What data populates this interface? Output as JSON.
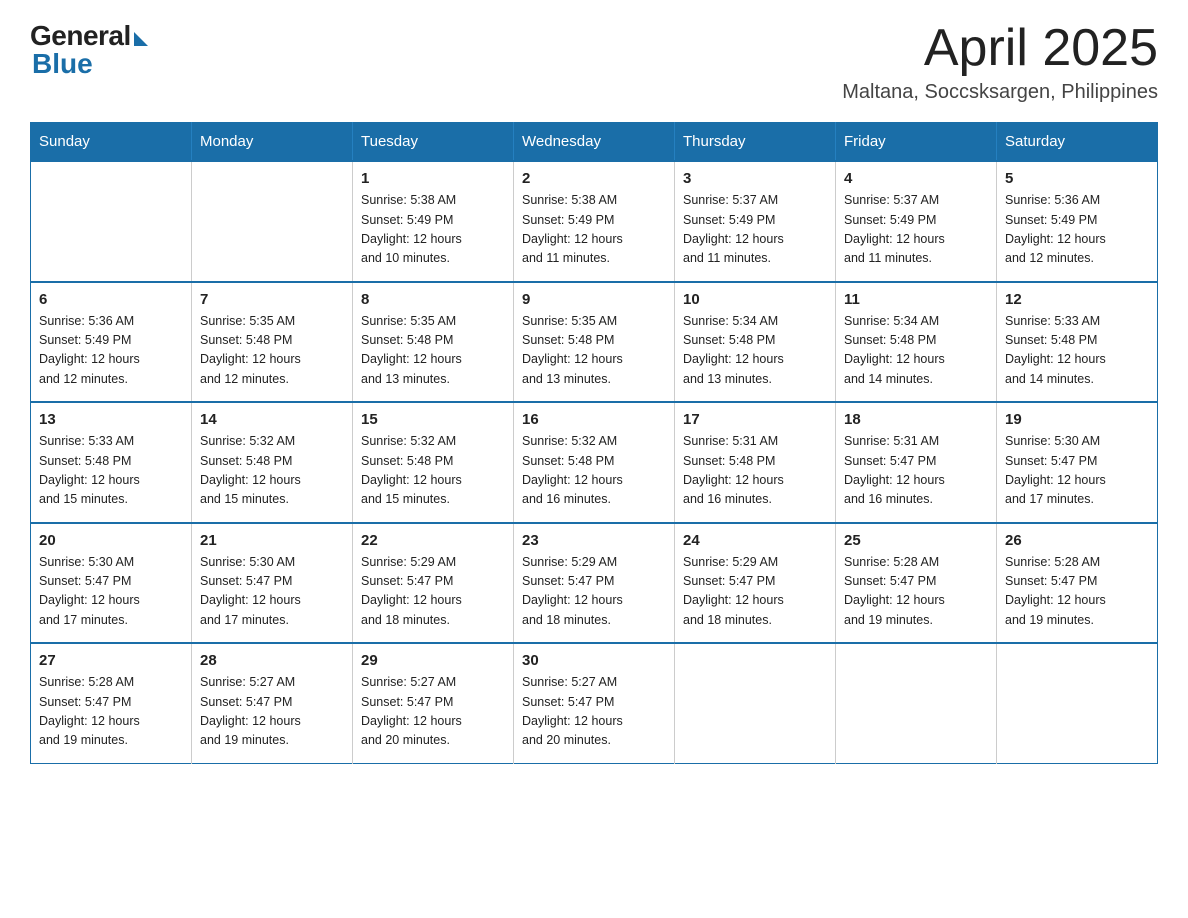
{
  "logo": {
    "general": "General",
    "blue": "Blue"
  },
  "title": "April 2025",
  "subtitle": "Maltana, Soccsksargen, Philippines",
  "headers": [
    "Sunday",
    "Monday",
    "Tuesday",
    "Wednesday",
    "Thursday",
    "Friday",
    "Saturday"
  ],
  "weeks": [
    [
      {
        "day": "",
        "info": ""
      },
      {
        "day": "",
        "info": ""
      },
      {
        "day": "1",
        "info": "Sunrise: 5:38 AM\nSunset: 5:49 PM\nDaylight: 12 hours\nand 10 minutes."
      },
      {
        "day": "2",
        "info": "Sunrise: 5:38 AM\nSunset: 5:49 PM\nDaylight: 12 hours\nand 11 minutes."
      },
      {
        "day": "3",
        "info": "Sunrise: 5:37 AM\nSunset: 5:49 PM\nDaylight: 12 hours\nand 11 minutes."
      },
      {
        "day": "4",
        "info": "Sunrise: 5:37 AM\nSunset: 5:49 PM\nDaylight: 12 hours\nand 11 minutes."
      },
      {
        "day": "5",
        "info": "Sunrise: 5:36 AM\nSunset: 5:49 PM\nDaylight: 12 hours\nand 12 minutes."
      }
    ],
    [
      {
        "day": "6",
        "info": "Sunrise: 5:36 AM\nSunset: 5:49 PM\nDaylight: 12 hours\nand 12 minutes."
      },
      {
        "day": "7",
        "info": "Sunrise: 5:35 AM\nSunset: 5:48 PM\nDaylight: 12 hours\nand 12 minutes."
      },
      {
        "day": "8",
        "info": "Sunrise: 5:35 AM\nSunset: 5:48 PM\nDaylight: 12 hours\nand 13 minutes."
      },
      {
        "day": "9",
        "info": "Sunrise: 5:35 AM\nSunset: 5:48 PM\nDaylight: 12 hours\nand 13 minutes."
      },
      {
        "day": "10",
        "info": "Sunrise: 5:34 AM\nSunset: 5:48 PM\nDaylight: 12 hours\nand 13 minutes."
      },
      {
        "day": "11",
        "info": "Sunrise: 5:34 AM\nSunset: 5:48 PM\nDaylight: 12 hours\nand 14 minutes."
      },
      {
        "day": "12",
        "info": "Sunrise: 5:33 AM\nSunset: 5:48 PM\nDaylight: 12 hours\nand 14 minutes."
      }
    ],
    [
      {
        "day": "13",
        "info": "Sunrise: 5:33 AM\nSunset: 5:48 PM\nDaylight: 12 hours\nand 15 minutes."
      },
      {
        "day": "14",
        "info": "Sunrise: 5:32 AM\nSunset: 5:48 PM\nDaylight: 12 hours\nand 15 minutes."
      },
      {
        "day": "15",
        "info": "Sunrise: 5:32 AM\nSunset: 5:48 PM\nDaylight: 12 hours\nand 15 minutes."
      },
      {
        "day": "16",
        "info": "Sunrise: 5:32 AM\nSunset: 5:48 PM\nDaylight: 12 hours\nand 16 minutes."
      },
      {
        "day": "17",
        "info": "Sunrise: 5:31 AM\nSunset: 5:48 PM\nDaylight: 12 hours\nand 16 minutes."
      },
      {
        "day": "18",
        "info": "Sunrise: 5:31 AM\nSunset: 5:47 PM\nDaylight: 12 hours\nand 16 minutes."
      },
      {
        "day": "19",
        "info": "Sunrise: 5:30 AM\nSunset: 5:47 PM\nDaylight: 12 hours\nand 17 minutes."
      }
    ],
    [
      {
        "day": "20",
        "info": "Sunrise: 5:30 AM\nSunset: 5:47 PM\nDaylight: 12 hours\nand 17 minutes."
      },
      {
        "day": "21",
        "info": "Sunrise: 5:30 AM\nSunset: 5:47 PM\nDaylight: 12 hours\nand 17 minutes."
      },
      {
        "day": "22",
        "info": "Sunrise: 5:29 AM\nSunset: 5:47 PM\nDaylight: 12 hours\nand 18 minutes."
      },
      {
        "day": "23",
        "info": "Sunrise: 5:29 AM\nSunset: 5:47 PM\nDaylight: 12 hours\nand 18 minutes."
      },
      {
        "day": "24",
        "info": "Sunrise: 5:29 AM\nSunset: 5:47 PM\nDaylight: 12 hours\nand 18 minutes."
      },
      {
        "day": "25",
        "info": "Sunrise: 5:28 AM\nSunset: 5:47 PM\nDaylight: 12 hours\nand 19 minutes."
      },
      {
        "day": "26",
        "info": "Sunrise: 5:28 AM\nSunset: 5:47 PM\nDaylight: 12 hours\nand 19 minutes."
      }
    ],
    [
      {
        "day": "27",
        "info": "Sunrise: 5:28 AM\nSunset: 5:47 PM\nDaylight: 12 hours\nand 19 minutes."
      },
      {
        "day": "28",
        "info": "Sunrise: 5:27 AM\nSunset: 5:47 PM\nDaylight: 12 hours\nand 19 minutes."
      },
      {
        "day": "29",
        "info": "Sunrise: 5:27 AM\nSunset: 5:47 PM\nDaylight: 12 hours\nand 20 minutes."
      },
      {
        "day": "30",
        "info": "Sunrise: 5:27 AM\nSunset: 5:47 PM\nDaylight: 12 hours\nand 20 minutes."
      },
      {
        "day": "",
        "info": ""
      },
      {
        "day": "",
        "info": ""
      },
      {
        "day": "",
        "info": ""
      }
    ]
  ]
}
